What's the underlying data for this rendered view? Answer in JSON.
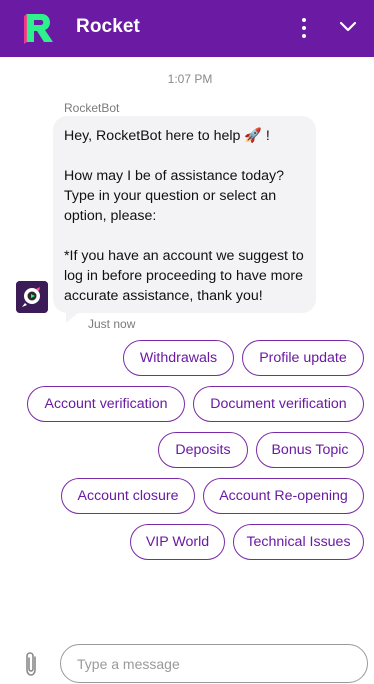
{
  "header": {
    "title": "Rocket",
    "logo_letter": "R",
    "background": "#6a1aa3",
    "icons": [
      "kebab-menu-icon",
      "chevron-down-icon"
    ]
  },
  "chat": {
    "timestamp": "1:07 PM",
    "sender": "RocketBot",
    "message": {
      "line1": "Hey, RocketBot here to help 🚀 !",
      "line2": "How may I be of assistance today? Type in your question or select an option, please:",
      "line3": "*If you have an account we suggest to log in before proceeding to have more accurate assistance, thank you!"
    },
    "status": "Just now"
  },
  "quick_replies": [
    "Withdrawals",
    "Profile update",
    "Account verification",
    "Document verification",
    "Deposits",
    "Bonus Topic",
    "Account closure",
    "Account Re-opening",
    "VIP World",
    "Technical Issues"
  ],
  "composer": {
    "placeholder": "Type a message",
    "icons": [
      "paperclip-icon"
    ]
  },
  "colors": {
    "accent": "#6a1aa3",
    "chip_border": "#7a2aa6",
    "bubble": "#f3f3f6"
  }
}
